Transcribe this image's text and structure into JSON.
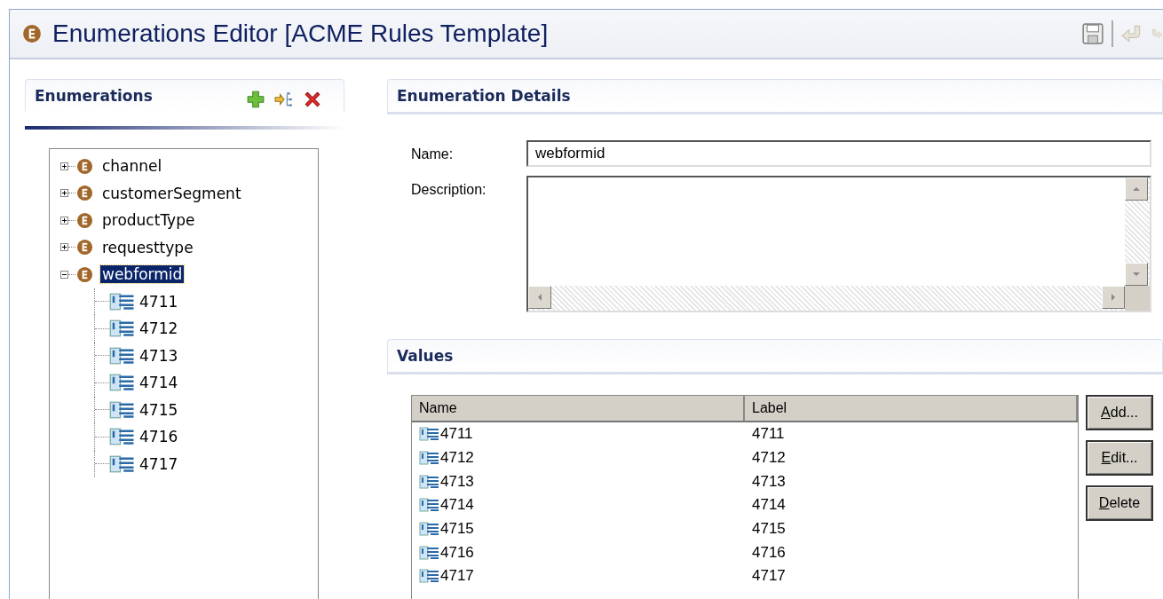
{
  "editor": {
    "title": "Enumerations Editor [ACME Rules Template]"
  },
  "enumerations_panel": {
    "title": "Enumerations",
    "tree": [
      {
        "label": "channel",
        "expanded": false,
        "selected": false
      },
      {
        "label": "customerSegment",
        "expanded": false,
        "selected": false
      },
      {
        "label": "productType",
        "expanded": false,
        "selected": false
      },
      {
        "label": "requesttype",
        "expanded": false,
        "selected": false
      },
      {
        "label": "webformid",
        "expanded": true,
        "selected": true,
        "children": [
          {
            "label": "4711"
          },
          {
            "label": "4712"
          },
          {
            "label": "4713"
          },
          {
            "label": "4714"
          },
          {
            "label": "4715"
          },
          {
            "label": "4716"
          },
          {
            "label": "4717"
          }
        ]
      }
    ]
  },
  "details": {
    "title": "Enumeration Details",
    "name_label": "Name:",
    "name_value": "webformid",
    "description_label": "Description:"
  },
  "values": {
    "title": "Values",
    "columns": [
      "Name",
      "Label"
    ],
    "rows": [
      [
        "4711",
        "4711"
      ],
      [
        "4712",
        "4712"
      ],
      [
        "4713",
        "4713"
      ],
      [
        "4714",
        "4714"
      ],
      [
        "4715",
        "4715"
      ],
      [
        "4716",
        "4716"
      ],
      [
        "4717",
        "4717"
      ]
    ],
    "buttons": [
      "Add...",
      "Edit...",
      "Delete"
    ]
  }
}
